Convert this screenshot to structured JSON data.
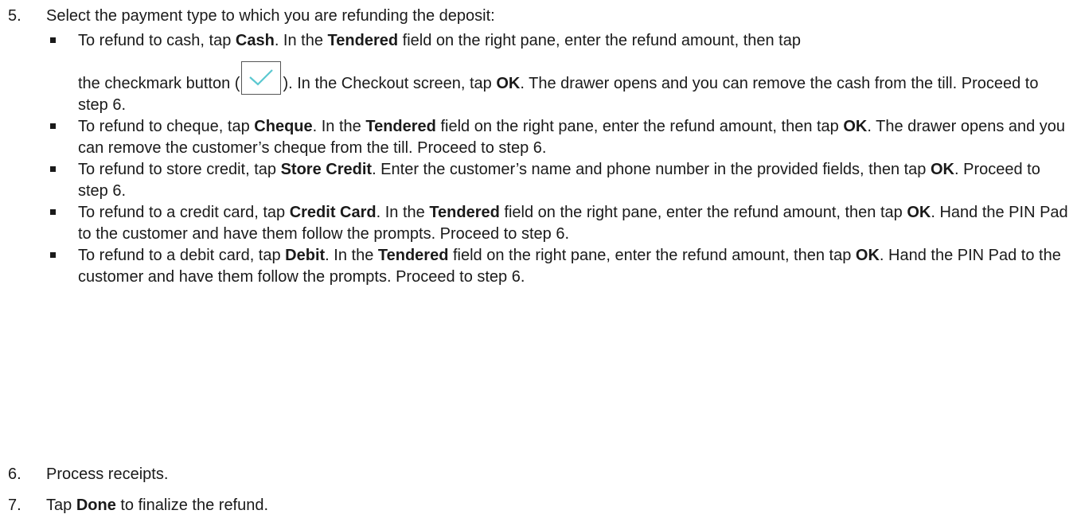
{
  "step5": {
    "number": "5.",
    "text": "Select the payment type to which you are refunding the deposit:"
  },
  "bullets": {
    "cash": {
      "t1": "To refund to cash, tap ",
      "b1": "Cash",
      "t2": ". In the ",
      "b2": "Tendered",
      "t3": " field on the right pane, enter the refund amount, then tap",
      "t4": "the checkmark button (",
      "t5": "). In the Checkout screen, tap ",
      "b3": "OK",
      "t6": ". The drawer opens and you can remove the cash from the till. Proceed to step 6."
    },
    "cheque": {
      "t1": "To refund to cheque, tap ",
      "b1": "Cheque",
      "t2": ". In the ",
      "b2": "Tendered",
      "t3": " field on the right pane, enter the refund amount, then tap ",
      "b3": "OK",
      "t4": ". The drawer opens and you can remove the customer’s cheque from the till. Proceed to step 6."
    },
    "store_credit": {
      "t1": "To refund to store credit, tap ",
      "b1": "Store Credit",
      "t2": ". Enter the customer’s name and phone number in the provided fields, then tap ",
      "b2": "OK",
      "t3": ". Proceed to step 6."
    },
    "credit_card": {
      "t1": "To refund to a credit card, tap ",
      "b1": "Credit Card",
      "t2": ". In the ",
      "b2": "Tendered",
      "t3": " field on the right pane, enter the refund amount, then tap ",
      "b3": "OK",
      "t4": ". Hand the PIN Pad to the customer and have them follow the prompts. Proceed to step 6."
    },
    "debit": {
      "t1": "To refund to a debit card, tap ",
      "b1": "Debit",
      "t2": ". In the ",
      "b2": "Tendered",
      "t3": " field on the right pane, enter the refund amount, then tap ",
      "b3": "OK",
      "t4": ". Hand the PIN Pad to the customer and have them follow the prompts. Proceed to step 6."
    }
  },
  "step6": {
    "number": "6.",
    "text": "Process receipts."
  },
  "step7": {
    "number": "7.",
    "t1": "Tap ",
    "b1": "Done",
    "t2": " to finalize the refund."
  },
  "icons": {
    "checkmark": "checkmark-icon",
    "checkmark_color": "#5bc8d0"
  }
}
